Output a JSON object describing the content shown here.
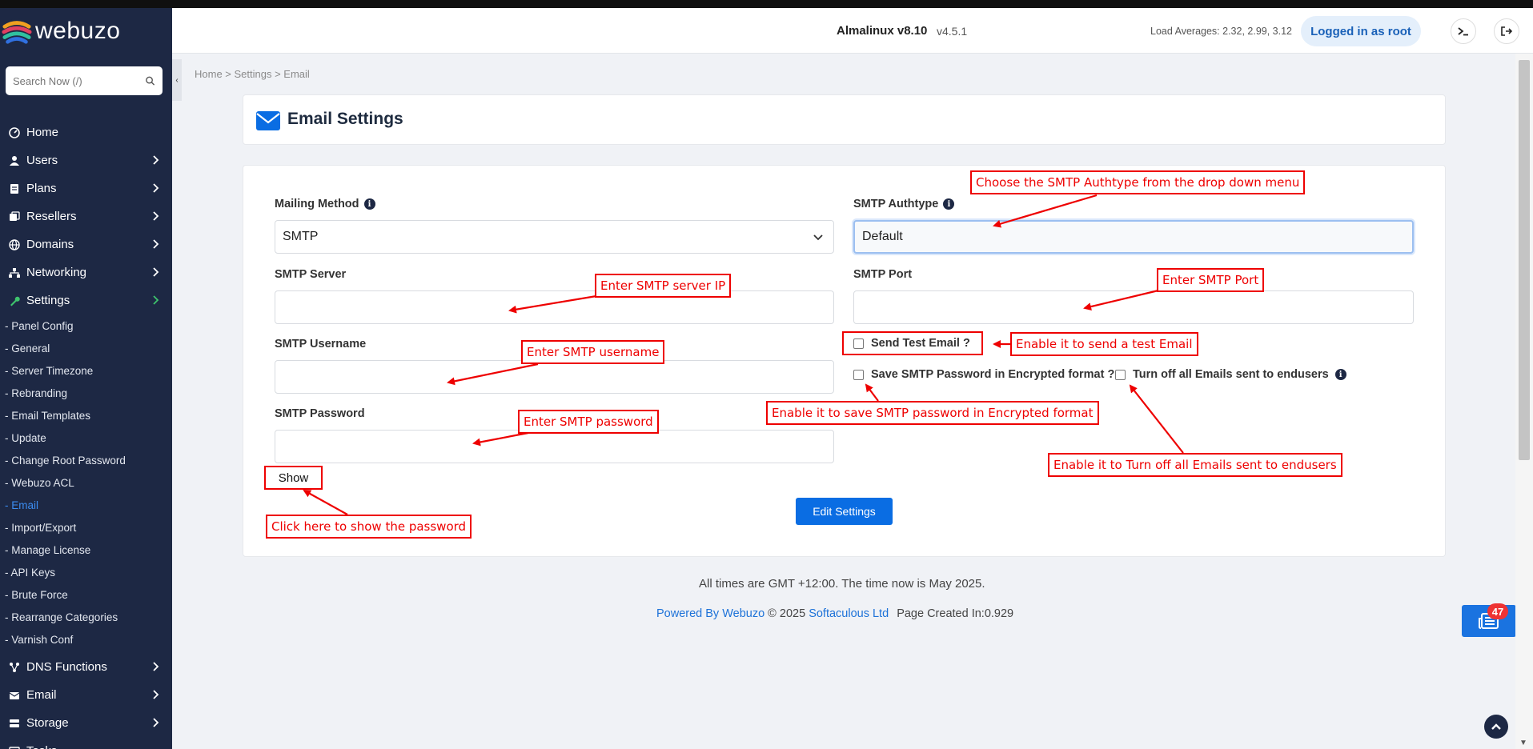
{
  "app": {
    "brand": "webuzo"
  },
  "sidebar": {
    "search_placeholder": "Search Now (/)",
    "items": [
      {
        "label": "Home",
        "icon": "dashboard-icon",
        "has_children": false
      },
      {
        "label": "Users",
        "icon": "user-icon",
        "has_children": true
      },
      {
        "label": "Plans",
        "icon": "plan-icon",
        "has_children": true
      },
      {
        "label": "Resellers",
        "icon": "resellers-icon",
        "has_children": true
      },
      {
        "label": "Domains",
        "icon": "globe-icon",
        "has_children": true
      },
      {
        "label": "Networking",
        "icon": "network-icon",
        "has_children": true
      },
      {
        "label": "Settings",
        "icon": "wrench-icon",
        "has_children": true
      }
    ],
    "settings_sub": [
      "- Panel Config",
      "- General",
      "- Server Timezone",
      "- Rebranding",
      "- Email Templates",
      "- Update",
      "- Change Root Password",
      "- Webuzo ACL",
      "- Email",
      "- Import/Export",
      "- Manage License",
      "- API Keys",
      "- Brute Force",
      "- Rearrange Categories",
      "- Varnish Conf"
    ],
    "active_sub_index": 8,
    "items_after": [
      {
        "label": "DNS Functions",
        "icon": "dns-icon"
      },
      {
        "label": "Email",
        "icon": "envelope-icon"
      },
      {
        "label": "Storage",
        "icon": "storage-icon"
      },
      {
        "label": "Tasks",
        "icon": "tasks-icon"
      }
    ]
  },
  "header": {
    "os": "Almalinux v8.10",
    "version": "v4.5.1",
    "load_averages": "Load Averages: 2.32, 2.99, 3.12",
    "login_label": "Logged in as root"
  },
  "breadcrumb": "Home > Settings > Email",
  "page": {
    "title": "Email Settings"
  },
  "form": {
    "mailing_method_label": "Mailing Method",
    "mailing_method_value": "SMTP",
    "smtp_authtype_label": "SMTP Authtype",
    "smtp_authtype_value": "Default",
    "smtp_server_label": "SMTP Server",
    "smtp_server_value": "",
    "smtp_port_label": "SMTP Port",
    "smtp_port_value": "",
    "smtp_username_label": "SMTP Username",
    "smtp_username_value": "",
    "smtp_password_label": "SMTP Password",
    "smtp_password_value": "",
    "send_test_label": "Send Test Email ?",
    "save_encrypted_label": "Save SMTP Password in Encrypted format ?",
    "turn_off_label": "Turn off all Emails sent to endusers",
    "show_label": "Show",
    "submit_label": "Edit Settings"
  },
  "footer": {
    "time_note": "All times are GMT +12:00. The time now is May 2025.",
    "powered_by": "Powered By Webuzo",
    "copyright": "© 2025",
    "company": "Softaculous Ltd",
    "page_created": "Page Created In:0.929"
  },
  "notification_count": "47",
  "annotations": {
    "authtype": "Choose the SMTP Authtype from the drop down menu",
    "server": "Enter SMTP server IP",
    "port": "Enter SMTP Port",
    "username": "Enter SMTP username",
    "test_email": "Enable it to send a test Email",
    "encrypted": "Enable it to save SMTP password in Encrypted format",
    "password": "Enter SMTP password",
    "turn_off": "Enable it to Turn off all Emails sent to endusers",
    "show": "Click here to show the password"
  },
  "colors": {
    "sidebar_bg": "#1d2844",
    "accent": "#0a6de3",
    "annotation": "#e00000",
    "active_link": "#3b8cf0"
  }
}
